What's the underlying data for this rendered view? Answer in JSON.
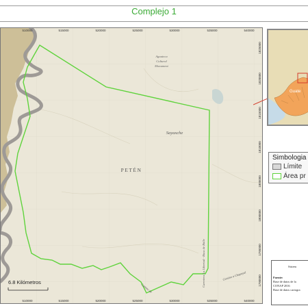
{
  "title": "Complejo 1",
  "map": {
    "labels": {
      "peten": "PETÉN",
      "sayaxche": "Sayaxche",
      "aguateca_line1": "Aguateca",
      "aguateca_line2": "Cultural",
      "aguateca_line3": "Monument",
      "boundary_road": "Carretera La Libertad - Boca de Bolle",
      "road_chapayal": "Camino a Chapayal",
      "road_bottom": "Camino de"
    },
    "coords_top": [
      "510000",
      "515000",
      "520000",
      "525000",
      "530000",
      "535000",
      "540000"
    ],
    "coords_bottom": [
      "510000",
      "515000",
      "520000",
      "525000",
      "530000",
      "535000",
      "540000"
    ],
    "coords_right": [
      "1825000",
      "1820000",
      "1815000",
      "1810000",
      "1805000",
      "1800000",
      "1795000",
      "1790000",
      "1785000"
    ],
    "colors": {
      "protected_area": "#5fd33c",
      "water": "#9e9a96",
      "terrain": "#ebe7d8",
      "outer_region": "#cdbf98"
    }
  },
  "inset": {
    "label": "Guate",
    "colors": {
      "country": "#f2a45a",
      "outline": "#d43b2a",
      "land": "#e8ddb6",
      "sea": "#c6dbe8"
    }
  },
  "legend": {
    "title": "Simbologia",
    "items": [
      {
        "label": "Límite",
        "swatch": "limit-swatch",
        "color": "#d9d9d9"
      },
      {
        "label": "Área pr",
        "swatch": "area-swatch",
        "color": "#5fd33c"
      }
    ]
  },
  "sources": {
    "lines": [
      "Sistem",
      "Fuente:",
      "Base de datos de la",
      "CONAP 2016",
      "Base de datos cartogra"
    ]
  },
  "scale": {
    "label": "6.8 Kilómetros"
  }
}
